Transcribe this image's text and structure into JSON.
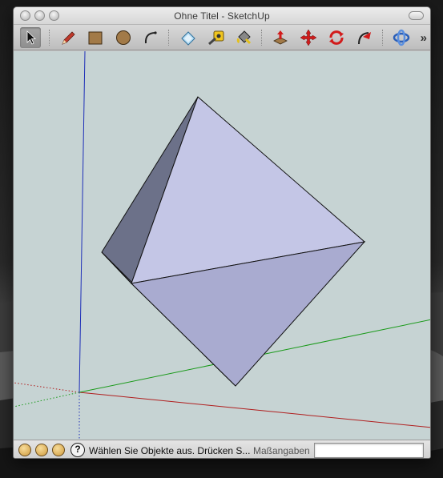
{
  "window": {
    "title": "Ohne Titel - SketchUp"
  },
  "toolbar": {
    "tools": [
      {
        "name": "select-tool",
        "icon": "arrow-cursor-icon",
        "selected": true
      },
      {
        "name": "pencil-tool",
        "icon": "pencil-icon"
      },
      {
        "name": "rectangle-tool",
        "icon": "rectangle-icon"
      },
      {
        "name": "circle-tool",
        "icon": "circle-icon"
      },
      {
        "name": "arc-tool",
        "icon": "arc-icon"
      },
      {
        "name": "eraser-tool",
        "icon": "eraser-icon"
      },
      {
        "name": "tape-measure-tool",
        "icon": "tape-measure-icon"
      },
      {
        "name": "paint-bucket-tool",
        "icon": "paint-bucket-icon"
      },
      {
        "name": "push-pull-tool",
        "icon": "push-pull-icon"
      },
      {
        "name": "move-tool",
        "icon": "move-icon"
      },
      {
        "name": "rotate-tool",
        "icon": "rotate-icon"
      },
      {
        "name": "follow-me-tool",
        "icon": "follow-me-icon"
      },
      {
        "name": "orbit-tool",
        "icon": "orbit-icon"
      }
    ],
    "overflow_label": "»"
  },
  "statusbar": {
    "icons": [
      "geolocation-icon",
      "credits-icon",
      "user-icon"
    ],
    "help_label": "?",
    "status_text": "Wählen Sie Objekte aus. Drücken S...",
    "measurements_label": "Maßangaben",
    "measurements_value": ""
  },
  "colors": {
    "viewport_bg": "#c6d3d3",
    "axis_red": "#b01e1e",
    "axis_green": "#1a9a1a",
    "axis_blue": "#1e2fb8",
    "face_light": "#c4c6e6",
    "face_mid": "#a9abd0",
    "face_dark": "#6c7189"
  }
}
